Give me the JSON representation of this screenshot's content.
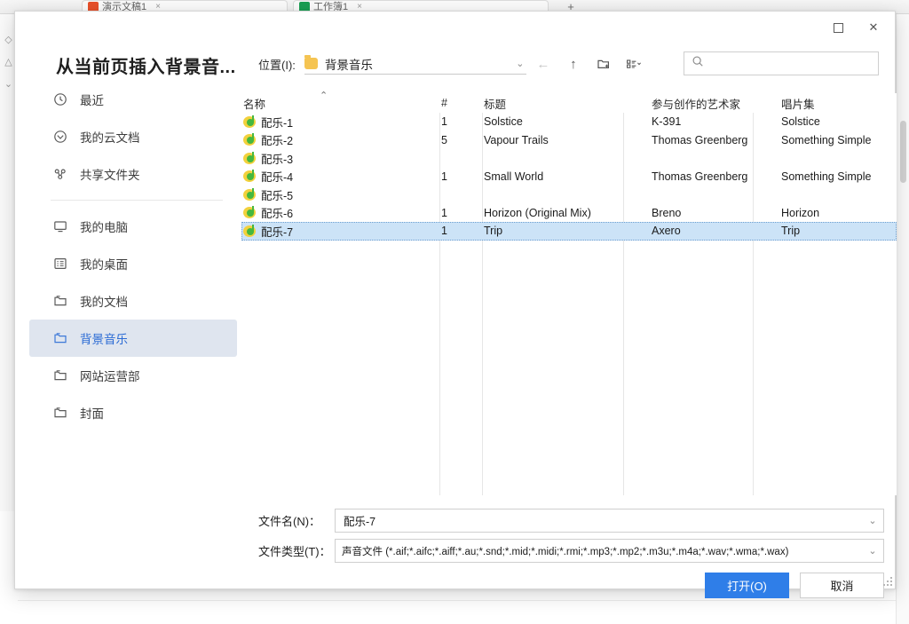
{
  "background_app": {
    "tabs": [
      {
        "label": "演示文稿1",
        "icon": "presentation-icon",
        "close": "×"
      },
      {
        "label": "工作簿1",
        "icon": "spreadsheet-icon",
        "close": "×"
      }
    ],
    "new_tab_label": "+"
  },
  "dialog": {
    "title": "从当前页插入背景音...",
    "window_controls": {
      "maximize": "maximize-icon",
      "close": "✕"
    },
    "sidebar": {
      "items": [
        {
          "label": "最近",
          "icon": "clock-icon",
          "active": false
        },
        {
          "label": "我的云文档",
          "icon": "cloud-icon",
          "active": false
        },
        {
          "label": "共享文件夹",
          "icon": "share-icon",
          "active": false
        },
        {
          "label": "我的电脑",
          "icon": "monitor-icon",
          "active": false
        },
        {
          "label": "我的桌面",
          "icon": "desktop-icon",
          "active": false
        },
        {
          "label": "我的文档",
          "icon": "folder-icon",
          "active": false
        },
        {
          "label": "背景音乐",
          "icon": "folder-icon",
          "active": true
        },
        {
          "label": "网站运营部",
          "icon": "folder-icon",
          "active": false
        },
        {
          "label": "封面",
          "icon": "folder-icon",
          "active": false
        }
      ]
    },
    "location": {
      "label": "位置(I):",
      "value": "背景音乐",
      "folder_icon": "folder-icon",
      "dropdown_icon": "chevron-down-icon",
      "back_icon": "←",
      "up_icon": "↑",
      "new_folder_icon": "new-folder-icon",
      "view_icon": "view-options-icon",
      "view_caret": "⌄"
    },
    "search": {
      "placeholder": "",
      "value": "",
      "icon": "search-icon"
    },
    "file_list": {
      "columns": [
        "名称",
        "#",
        "标题",
        "参与创作的艺术家",
        "唱片集"
      ],
      "sort_indicator": "⌃",
      "rows": [
        {
          "name": "配乐-1",
          "num": "1",
          "title": "Solstice",
          "artist": "K-391",
          "album": "Solstice",
          "selected": false
        },
        {
          "name": "配乐-2",
          "num": "5",
          "title": "Vapour Trails",
          "artist": "Thomas Greenberg",
          "album": "Something Simple",
          "selected": false
        },
        {
          "name": "配乐-3",
          "num": "",
          "title": "",
          "artist": "",
          "album": "",
          "selected": false
        },
        {
          "name": "配乐-4",
          "num": "1",
          "title": "Small World",
          "artist": "Thomas Greenberg",
          "album": "Something Simple",
          "selected": false
        },
        {
          "name": "配乐-5",
          "num": "",
          "title": "",
          "artist": "",
          "album": "",
          "selected": false
        },
        {
          "name": "配乐-6",
          "num": "1",
          "title": "Horizon (Original Mix)",
          "artist": "Breno",
          "album": "Horizon",
          "selected": false
        },
        {
          "name": "配乐-7",
          "num": "1",
          "title": "Trip",
          "artist": "Axero",
          "album": "Trip",
          "selected": true
        }
      ]
    },
    "form": {
      "filename_label": "文件名(N)：",
      "filename_value": "配乐-7",
      "filetype_label": "文件类型(T)：",
      "filetype_value": "声音文件 (*.aif;*.aifc;*.aiff;*.au;*.snd;*.mid;*.midi;*.rmi;*.mp3;*.mp2;*.m3u;*.m4a;*.wav;*.wma;*.wax)",
      "dropdown_icon": "chevron-down-icon"
    },
    "buttons": {
      "open_label": "打开(O)",
      "cancel_label": "取消",
      "open_color": "#2f7ee8"
    }
  }
}
